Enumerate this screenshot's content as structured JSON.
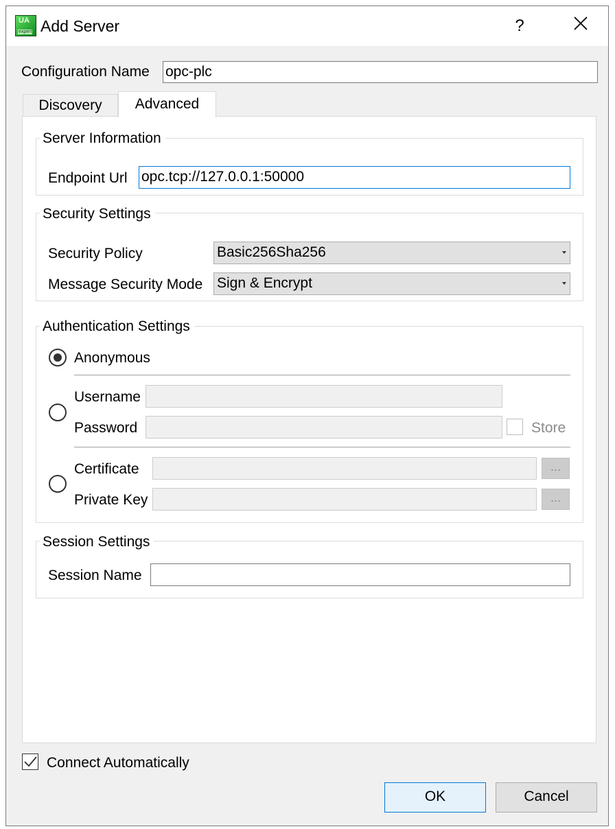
{
  "window": {
    "title": "Add Server",
    "help_label": "?"
  },
  "configuration": {
    "label": "Configuration Name",
    "value": "opc-plc"
  },
  "tabs": [
    {
      "label": "Discovery",
      "selected": false
    },
    {
      "label": "Advanced",
      "selected": true
    }
  ],
  "server_info": {
    "title": "Server Information",
    "endpoint_label": "Endpoint Url",
    "endpoint_value": "opc.tcp://127.0.0.1:50000"
  },
  "security": {
    "title": "Security Settings",
    "policy_label": "Security Policy",
    "policy_value": "Basic256Sha256",
    "mode_label": "Message Security Mode",
    "mode_value": "Sign & Encrypt"
  },
  "auth": {
    "title": "Authentication Settings",
    "selected": "Anonymous",
    "anonymous_label": "Anonymous",
    "username_label": "Username",
    "username_value": "",
    "password_label": "Password",
    "password_value": "",
    "store_label": "Store",
    "store_checked": false,
    "certificate_label": "Certificate",
    "certificate_value": "",
    "private_key_label": "Private Key",
    "private_key_value": "",
    "browse_label": "..."
  },
  "session": {
    "title": "Session Settings",
    "name_label": "Session Name",
    "name_value": ""
  },
  "connect_automatically": {
    "label": "Connect Automatically",
    "checked": true
  },
  "buttons": {
    "ok": "OK",
    "cancel": "Cancel"
  },
  "colors": {
    "focus_border": "#0078d7",
    "ok_background": "#e5f1fb",
    "dialog_background": "#f0f0f0"
  }
}
